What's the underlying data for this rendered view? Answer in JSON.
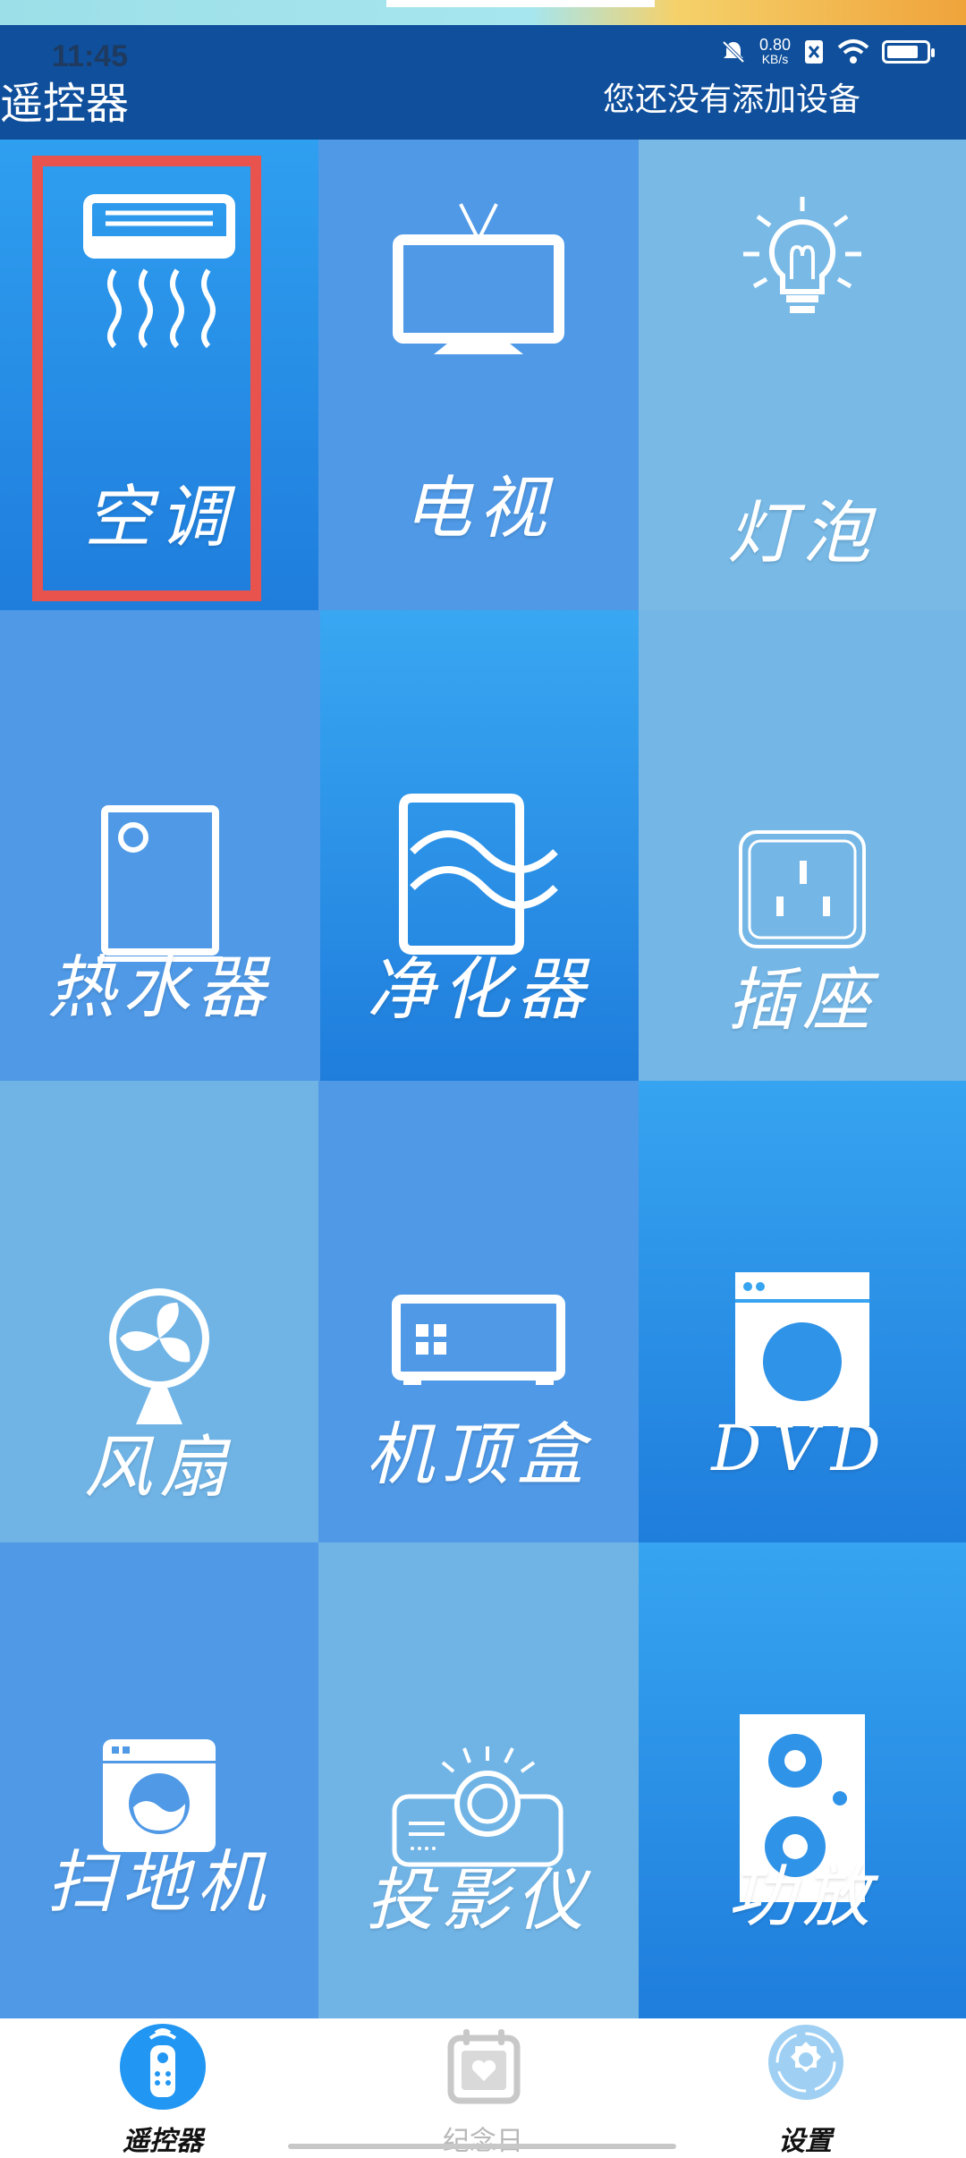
{
  "status_bar": {
    "time": "11:45",
    "speed_value": "0.80",
    "speed_unit": "KB/s"
  },
  "header": {
    "title": "遥控器",
    "subtitle": "您还没有添加设备"
  },
  "tiles": [
    {
      "label": "空调",
      "icon": "air-conditioner-icon",
      "selected": true
    },
    {
      "label": "电视",
      "icon": "tv-icon"
    },
    {
      "label": "灯泡",
      "icon": "light-bulb-icon"
    },
    {
      "label": "热水器",
      "icon": "water-heater-icon"
    },
    {
      "label": "净化器",
      "icon": "air-purifier-icon"
    },
    {
      "label": "插座",
      "icon": "power-socket-icon"
    },
    {
      "label": "风扇",
      "icon": "fan-icon"
    },
    {
      "label": "机顶盒",
      "icon": "set-top-box-icon"
    },
    {
      "label": "DVD",
      "icon": "washing-machine-icon"
    },
    {
      "label": "扫地机",
      "icon": "robot-vacuum-icon"
    },
    {
      "label": "投影仪",
      "icon": "projector-icon"
    },
    {
      "label": "功放",
      "icon": "speaker-icon"
    }
  ],
  "bottom_nav": {
    "items": [
      {
        "label": "遥控器",
        "icon": "remote-control-icon",
        "active": true
      },
      {
        "label": "纪念日",
        "icon": "calendar-heart-icon",
        "active": false
      },
      {
        "label": "设置",
        "icon": "settings-gear-icon",
        "active": false
      }
    ]
  },
  "colors": {
    "header_bg": "#0f4f9b",
    "selection_border": "#e8534e",
    "tile_dark": "#2f8fe6",
    "tile_mid": "#4d9ae8",
    "tile_light": "#74b6e6"
  }
}
